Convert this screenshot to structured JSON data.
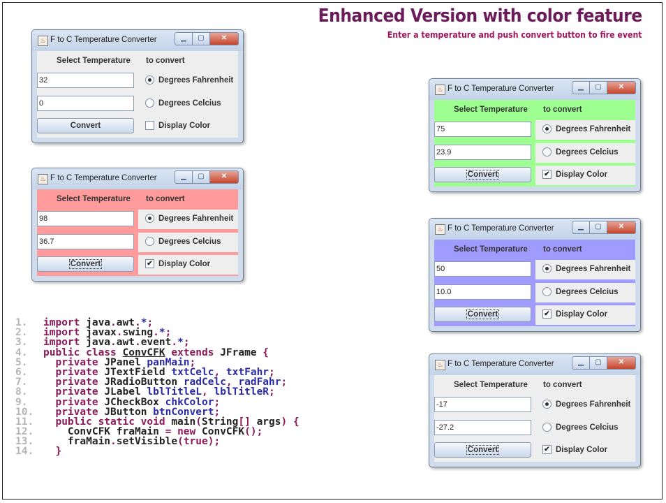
{
  "slide": {
    "title": "Enhanced Version with color feature",
    "subtitle": "Enter a temperature and push convert button to fire event"
  },
  "window_title": "F to C Temperature Converter",
  "labels": {
    "select_left": "Select Temperature",
    "select_right": "to convert",
    "radio_fahr": "Degrees Fahrenheit",
    "radio_celc": "Degrees Celcius",
    "convert": "Convert",
    "display_color": "Display Color"
  },
  "windows": [
    {
      "id": "default",
      "fahr": "32",
      "celc": "0",
      "display_color_checked": false,
      "bg_color": "#eeeeee"
    },
    {
      "id": "red",
      "fahr": "98",
      "celc": "36.7",
      "display_color_checked": true,
      "bg_color": "#ff9b9b"
    },
    {
      "id": "green",
      "fahr": "75",
      "celc": "23.9",
      "display_color_checked": true,
      "bg_color": "#9cff90"
    },
    {
      "id": "blue",
      "fahr": "50",
      "celc": "10.0",
      "display_color_checked": true,
      "bg_color": "#a09bff"
    },
    {
      "id": "gray",
      "fahr": "-17",
      "celc": "-27.2",
      "display_color_checked": true,
      "bg_color": "#eeeeee"
    }
  ],
  "code_lines": [
    {
      "num": "1.",
      "parts": [
        [
          "kw",
          "import "
        ],
        [
          "pl",
          "java"
        ],
        [
          "kw",
          "."
        ],
        [
          "pl",
          "awt"
        ],
        [
          "kw",
          "."
        ],
        [
          "id",
          "*"
        ],
        [
          "kw",
          ";"
        ]
      ]
    },
    {
      "num": "2.",
      "parts": [
        [
          "kw",
          "import "
        ],
        [
          "pl",
          "javax"
        ],
        [
          "kw",
          "."
        ],
        [
          "pl",
          "swing"
        ],
        [
          "kw",
          "."
        ],
        [
          "id",
          "*"
        ],
        [
          "kw",
          ";"
        ]
      ]
    },
    {
      "num": "3.",
      "parts": [
        [
          "kw",
          "import "
        ],
        [
          "pl",
          "java"
        ],
        [
          "kw",
          "."
        ],
        [
          "pl",
          "awt"
        ],
        [
          "kw",
          "."
        ],
        [
          "pl",
          "event"
        ],
        [
          "kw",
          "."
        ],
        [
          "id",
          "*"
        ],
        [
          "kw",
          ";"
        ]
      ]
    },
    {
      "num": "4.",
      "parts": [
        [
          "kw",
          "public class "
        ],
        [
          "u",
          "ConvCFK"
        ],
        [
          "kw",
          " extends "
        ],
        [
          "pl",
          "JFrame"
        ],
        [
          "kw",
          " {"
        ]
      ]
    },
    {
      "num": "5.",
      "parts": [
        [
          "kw",
          "  private "
        ],
        [
          "pl",
          "JPanel "
        ],
        [
          "id",
          "panMain"
        ],
        [
          "kw",
          ";"
        ]
      ]
    },
    {
      "num": "6.",
      "parts": [
        [
          "kw",
          "  private "
        ],
        [
          "pl",
          "JTextField "
        ],
        [
          "id",
          "txtCelc"
        ],
        [
          "kw",
          ", "
        ],
        [
          "id",
          "txtFahr"
        ],
        [
          "kw",
          ";"
        ]
      ]
    },
    {
      "num": "7.",
      "parts": [
        [
          "kw",
          "  private "
        ],
        [
          "pl",
          "JRadioButton "
        ],
        [
          "id",
          "radCelc"
        ],
        [
          "kw",
          ", "
        ],
        [
          "id",
          "radFahr"
        ],
        [
          "kw",
          ";"
        ]
      ]
    },
    {
      "num": "8.",
      "parts": [
        [
          "kw",
          "  private "
        ],
        [
          "pl",
          "JLabel "
        ],
        [
          "id",
          "lblTitleL"
        ],
        [
          "kw",
          ", "
        ],
        [
          "id",
          "lblTitleR"
        ],
        [
          "kw",
          ";"
        ]
      ]
    },
    {
      "num": "9.",
      "parts": [
        [
          "kw",
          "  private "
        ],
        [
          "pl",
          "JCheckBox "
        ],
        [
          "id",
          "chkColor"
        ],
        [
          "kw",
          ";"
        ]
      ]
    },
    {
      "num": "10.",
      "parts": [
        [
          "kw",
          "  private "
        ],
        [
          "pl",
          "JButton "
        ],
        [
          "id",
          "btnConvert"
        ],
        [
          "kw",
          ";"
        ]
      ]
    },
    {
      "num": "11.",
      "parts": [
        [
          "kw",
          "  public static void "
        ],
        [
          "pl",
          "main"
        ],
        [
          "kw",
          "("
        ],
        [
          "pl",
          "String"
        ],
        [
          "kw",
          "[] "
        ],
        [
          "pl",
          "args"
        ],
        [
          "kw",
          ") {"
        ]
      ]
    },
    {
      "num": "12.",
      "parts": [
        [
          "pl",
          "    ConvCFK fraMain "
        ],
        [
          "kw",
          "= new "
        ],
        [
          "pl",
          "ConvCFK"
        ],
        [
          "kw",
          "();"
        ]
      ]
    },
    {
      "num": "13.",
      "parts": [
        [
          "pl",
          "    fraMain"
        ],
        [
          "kw",
          "."
        ],
        [
          "pl",
          "setVisible"
        ],
        [
          "kw",
          "("
        ],
        [
          "kw",
          "true"
        ],
        [
          "kw",
          ");"
        ]
      ]
    },
    {
      "num": "14.",
      "parts": [
        [
          "kw",
          "  }"
        ]
      ]
    }
  ]
}
